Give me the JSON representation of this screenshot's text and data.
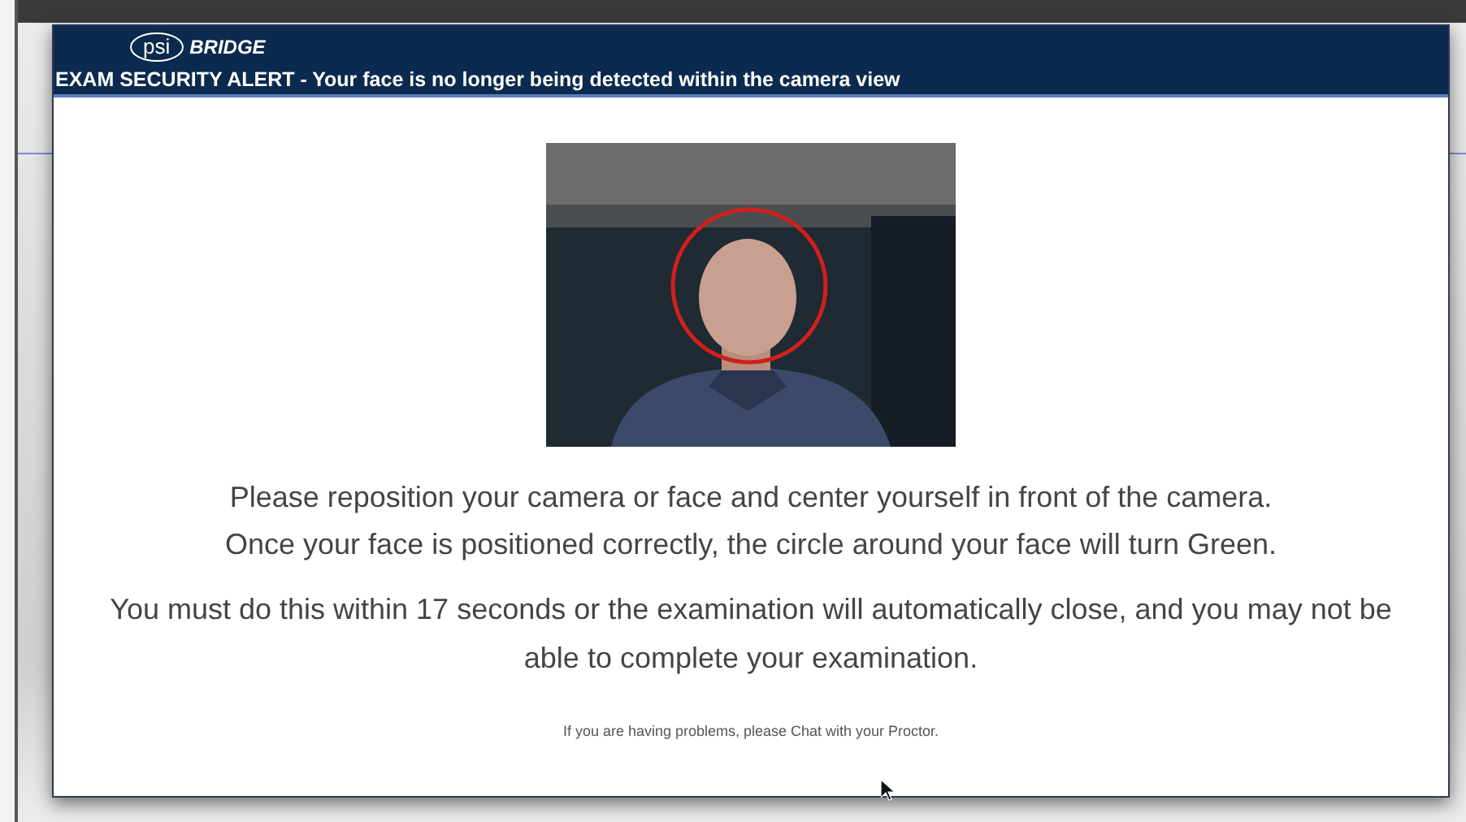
{
  "dialog": {
    "logo": {
      "mark": "psi",
      "name": "BRIDGE"
    },
    "title": "EXAM SECURITY ALERT - Your face is no longer being detected within the camera view",
    "instructions": [
      "Please reposition your camera or face and center yourself in front of the camera.",
      "Once your face is positioned correctly, the circle around your face will turn Green."
    ],
    "warning": "You must do this within 17 seconds or the examination will automatically close, and you may not be able to complete your examination.",
    "help": "If you are having problems, please Chat with your Proctor."
  }
}
